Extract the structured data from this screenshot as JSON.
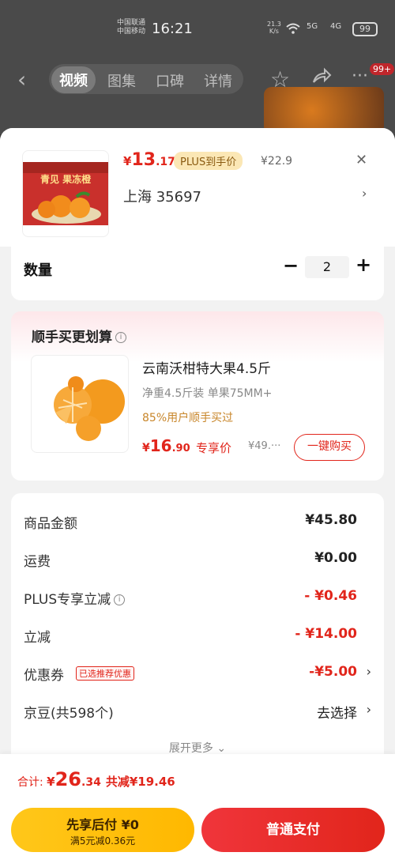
{
  "status_bar": {
    "carrier_1": "中国联通",
    "carrier_2": "中国移动",
    "time": "16:21",
    "net_speed_value": "21.3",
    "net_speed_unit": "K/s",
    "signal_5g": "5G",
    "signal_4g": "4G",
    "battery": "99"
  },
  "top_nav": {
    "tabs": [
      {
        "label": "视频"
      },
      {
        "label": "图集"
      },
      {
        "label": "口碑"
      },
      {
        "label": "详情"
      }
    ],
    "more_badge": "99+"
  },
  "product": {
    "price_yen": "¥",
    "price_int": "13",
    "price_dec": ".17",
    "plus_tag": "PLUS到手价",
    "original_price": "¥22.9",
    "location": "上海  35697",
    "image_label": "青见 果冻橙"
  },
  "quantity": {
    "label": "数量",
    "value": "2"
  },
  "upsell": {
    "title": "顺手买更划算",
    "item_name": "云南沃柑特大果4.5斤",
    "item_spec": "净重4.5斤装 单果75MM+",
    "item_users": "85%用户顺手买过",
    "price_yen": "¥",
    "price_int": "16",
    "price_dec": ".90",
    "price_label": "专享价",
    "orig_price": "¥49.···",
    "buy_button": "一键购买"
  },
  "summary": {
    "rows": [
      {
        "label": "商品金额",
        "value": "¥45.80"
      },
      {
        "label": "运费",
        "value": "¥0.00"
      },
      {
        "label": "PLUS专享立减",
        "value": "- ¥0.46"
      },
      {
        "label": "立减",
        "value": "- ¥14.00"
      },
      {
        "label": "优惠券",
        "value": "-¥5.00",
        "tag": "已选推荐优惠"
      },
      {
        "label": "京豆(共598个)",
        "value": "去选择"
      }
    ],
    "expand_more": "展开更多"
  },
  "footer": {
    "total_label": "合计: ",
    "total_yen": "¥",
    "total_int": "26",
    "total_dec": ".34",
    "total_saved": "共减¥19.46",
    "pay_later_title": "先享后付 ¥0",
    "pay_later_sub": "满5元减0.36元",
    "pay_button": "普通支付"
  },
  "colors": {
    "accent_red": "#e1251b",
    "plus_gold": "#fbe7b5",
    "pay_later_yellow": "#ffc71a"
  }
}
